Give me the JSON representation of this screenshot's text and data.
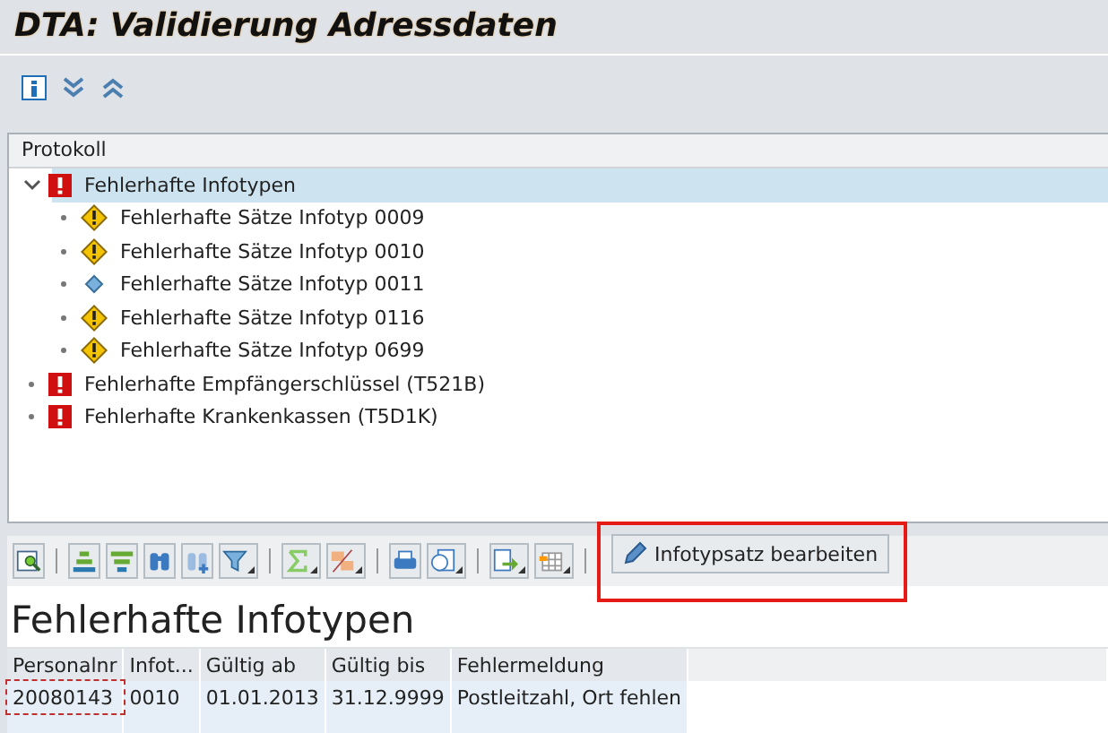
{
  "window": {
    "title": "DTA: Validierung Adressdaten"
  },
  "log": {
    "header": "Protokoll",
    "items": [
      {
        "label": "Fehlerhafte Infotypen",
        "kind": "error",
        "expanded": true,
        "selected": true,
        "children": [
          {
            "label": "Fehlerhafte Sätze Infotyp 0009",
            "kind": "warning",
            "selected": false
          },
          {
            "label": "Fehlerhafte Sätze Infotyp 0010",
            "kind": "warning",
            "selected": false
          },
          {
            "label": "Fehlerhafte Sätze Infotyp 0011",
            "kind": "info",
            "selected": false
          },
          {
            "label": "Fehlerhafte Sätze Infotyp 0116",
            "kind": "warning",
            "selected": false
          },
          {
            "label": "Fehlerhafte Sätze Infotyp 0699",
            "kind": "warning",
            "selected": false
          }
        ]
      },
      {
        "label": "Fehlerhafte Empfängerschlüssel (T521B)",
        "kind": "error",
        "selected": false
      },
      {
        "label": "Fehlerhafte Krankenkassen (T5D1K)",
        "kind": "error",
        "selected": false
      }
    ]
  },
  "grid": {
    "edit_button": "Infotypsatz bearbeiten",
    "title": "Fehlerhafte Infotypen",
    "columns": [
      "Personalnr",
      "Infot...",
      "Gültig ab",
      "Gültig bis",
      "Fehlermeldung"
    ],
    "rows": [
      [
        "20080143",
        "0010",
        "01.01.2013",
        "31.12.9999",
        "Postleitzahl, Ort fehlen"
      ]
    ]
  }
}
